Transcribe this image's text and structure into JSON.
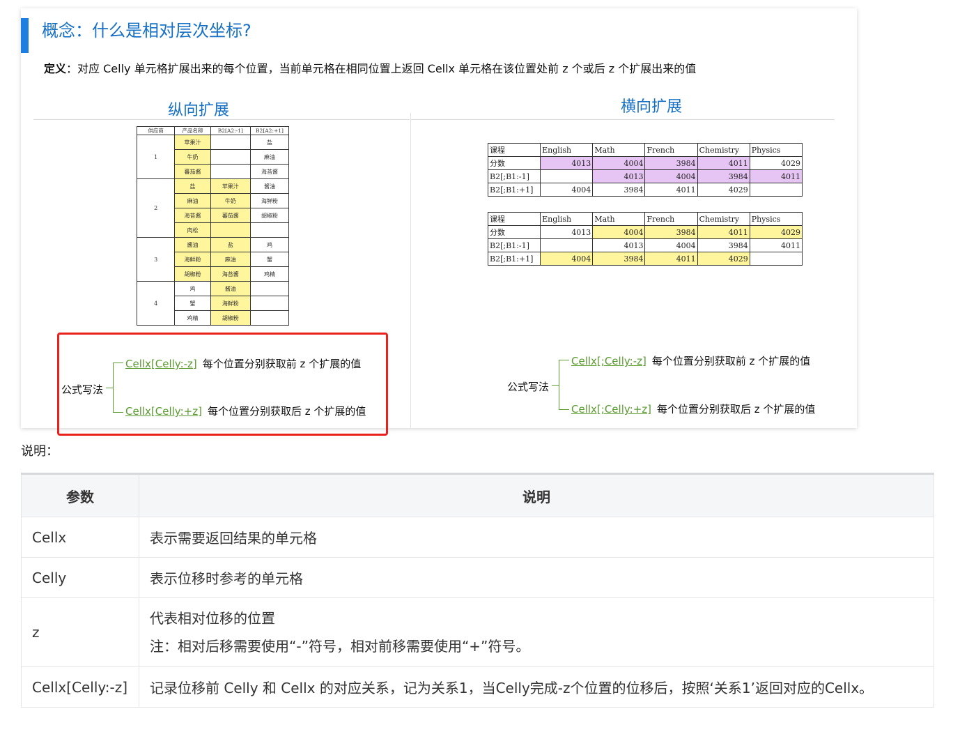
{
  "card": {
    "title": "概念：什么是相对层次坐标?",
    "definition_label": "定义",
    "definition_text": "：对应 Celly 单元格扩展出来的每个位置，当前单元格在相同位置上返回 Cellx 单元格在该位置处前 z 个或后 z 个扩展出来的值",
    "vertical_title": "纵向扩展",
    "horizontal_title": "横向扩展"
  },
  "vertical_table": {
    "headers": [
      "供应商",
      "产品名称",
      "B2[A2:-1]",
      "B2[A2:+1]"
    ],
    "groups": [
      {
        "supplier": "1",
        "rows": [
          [
            "苹果汁",
            "",
            "盐"
          ],
          [
            "牛奶",
            "",
            "麻油"
          ],
          [
            "蕃茄酱",
            "",
            "海苔酱"
          ]
        ]
      },
      {
        "supplier": "2",
        "rows": [
          [
            "盐",
            "苹果汁",
            "酱油"
          ],
          [
            "麻油",
            "牛奶",
            "海鲜粉"
          ],
          [
            "海苔酱",
            "蕃茄酱",
            "胡椒粉"
          ],
          [
            "肉松",
            "",
            ""
          ]
        ]
      },
      {
        "supplier": "3",
        "rows": [
          [
            "酱油",
            "盐",
            "鸡"
          ],
          [
            "海鲜粉",
            "麻油",
            "蟹"
          ],
          [
            "胡椒粉",
            "海苔酱",
            "鸡精"
          ]
        ]
      },
      {
        "supplier": "4",
        "rows": [
          [
            "鸡",
            "酱油",
            ""
          ],
          [
            "蟹",
            "海鲜粉",
            ""
          ],
          [
            "鸡精",
            "胡椒粉",
            ""
          ]
        ]
      }
    ]
  },
  "horizontal_tables": [
    {
      "rows": [
        [
          "课程",
          "English",
          "Math",
          "French",
          "Chemistry",
          "Physics"
        ],
        [
          "分数",
          "4013",
          "4004",
          "3984",
          "4011",
          "4029"
        ],
        [
          "B2[;B1:-1]",
          "",
          "4013",
          "4004",
          "3984",
          "4011"
        ],
        [
          "B2[;B1:+1]",
          "4004",
          "3984",
          "4011",
          "4029",
          ""
        ]
      ]
    },
    {
      "rows": [
        [
          "课程",
          "English",
          "Math",
          "French",
          "Chemistry",
          "Physics"
        ],
        [
          "分数",
          "4013",
          "4004",
          "3984",
          "4011",
          "4029"
        ],
        [
          "B2[;B1:-1]",
          "",
          "4013",
          "4004",
          "3984",
          "4011"
        ],
        [
          "B2[;B1:+1]",
          "4004",
          "3984",
          "4011",
          "4029",
          ""
        ]
      ]
    }
  ],
  "formulas": {
    "label": "公式写法",
    "vertical": [
      {
        "formula": "Cellx[Celly:-z]",
        "desc": "每个位置分别获取前 z 个扩展的值"
      },
      {
        "formula": "Cellx[Celly:+z]",
        "desc": "每个位置分别获取后 z 个扩展的值"
      }
    ],
    "horizontal": [
      {
        "formula": "Cellx[;Celly:-z]",
        "desc": "每个位置分别获取前 z 个扩展的值"
      },
      {
        "formula": "Cellx[;Celly:+z]",
        "desc": "每个位置分别获取后 z 个扩展的值"
      }
    ]
  },
  "note_label": "说明：",
  "params_table": {
    "headers": [
      "参数",
      "说明"
    ],
    "rows": [
      {
        "param": "Cellx",
        "desc": "表示需要返回结果的单元格"
      },
      {
        "param": "Celly",
        "desc": "表示位移时参考的单元格"
      },
      {
        "param": "z",
        "desc": "代表相对位移的位置",
        "desc2": "注：相对后移需要使用“-”符号，相对前移需要使用“+”符号。"
      },
      {
        "param": "Cellx[Celly:-z]",
        "desc": "记录位移前 Celly 和 Cellx 的对应关系，记为关系1，当Celly完成-z个位置的位移后，按照‘关系1’返回对应的Cellx。"
      }
    ]
  },
  "colors": {
    "accent": "#1670c5",
    "highlight_yellow": "#fff59d",
    "highlight_purple": "#e6c5f5",
    "formula_green": "#5a9a2f",
    "red_box": "#e8211d"
  }
}
